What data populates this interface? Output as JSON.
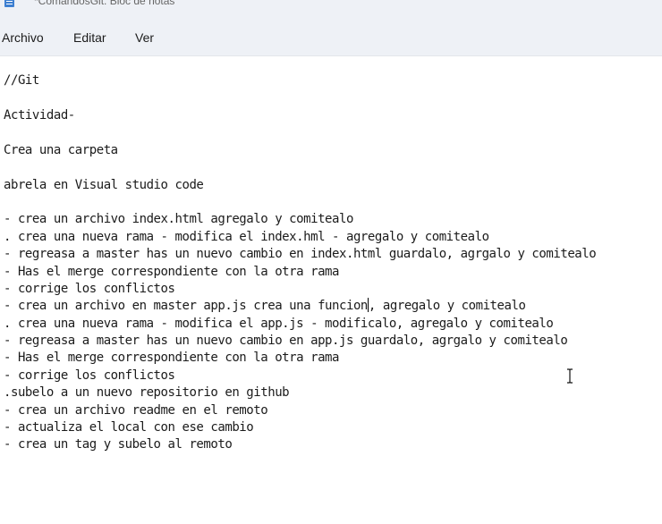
{
  "window": {
    "title": "*ComandosGit: Bloc de notas"
  },
  "menu": {
    "items": [
      {
        "label": "Archivo"
      },
      {
        "label": "Editar"
      },
      {
        "label": "Ver"
      }
    ]
  },
  "editor": {
    "lines": [
      "//Git",
      "Actividad-",
      "Crea una carpeta",
      "abrela en Visual studio code",
      "- crea un archivo index.html agregalo y comitealo",
      ". crea una nueva rama - modifica el index.hml - agregalo y comitealo",
      "- regreasa a master has un nuevo cambio en index.html guardalo, agrgalo y comitealo",
      "- Has el merge correspondiente con la otra rama",
      "- corrige los conflictos",
      "- crea un archivo en master app.js crea una funcion",
      ", agregalo y comitealo",
      ". crea una nueva rama - modifica el app.js - modificalo, agregalo y comitealo",
      "- regreasa a master has un nuevo cambio en app.js guardalo, agrgalo y comitealo",
      "- Has el merge correspondiente con la otra rama",
      "- corrige los conflictos",
      ".subelo a un nuevo repositorio en github",
      "- crea un archivo readme en el remoto",
      "- actualiza el local con ese cambio",
      "- crea un tag y subelo al remoto"
    ]
  },
  "icons": {
    "app": "notepad-icon",
    "cursor": "text-cursor-icon"
  }
}
